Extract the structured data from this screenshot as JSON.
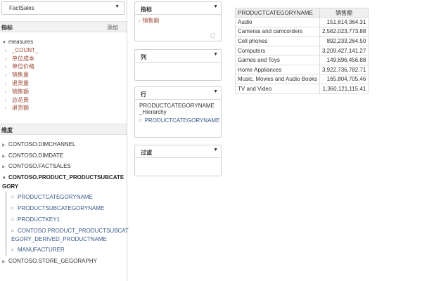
{
  "cube": {
    "selected": "FactSales"
  },
  "measures_section": {
    "title": "指标",
    "add_label": "添加"
  },
  "measures_root": "measures",
  "measures": [
    "_COUNT_",
    "单位成本",
    "单位价格",
    "销售量",
    "退货量",
    "销售额",
    "总花费",
    "退货额"
  ],
  "dimensions_section": {
    "title": "维度"
  },
  "dimensions": {
    "dim1": "CONTOSO.DIMCHANNEL",
    "dim2": "CONTOSO.DIMDATE",
    "dim3": "CONTOSO.FACTSALES",
    "dim4": "CONTOSO.PRODUCT_PRODUCTSUBCATEGORY",
    "dim5": "CONTOSO.STORE_GEGORAPHY"
  },
  "attributes": [
    "PRODUCTCATEGORYNAME",
    "PRODUCTSUBCATEGORYNAME",
    "PRODUCTKEY1",
    "CONTOSO.PRODUCT_PRODUCTSUBCATEGORY_DERIVED_PRODUCTNAME",
    "MANUFACTURER"
  ],
  "panels": {
    "measures": {
      "title": "指标",
      "item": "销售额"
    },
    "columns": {
      "title": "列"
    },
    "rows": {
      "title": "行",
      "hierarchy": "PRODUCTCATEGORYNAME_Hierarchy",
      "item": "PRODUCTCATEGORYNAME"
    },
    "filters": {
      "title": "过滤"
    }
  },
  "table": {
    "headers": [
      "PRODUCTCATEGORYNAME",
      "销售额"
    ],
    "rows": [
      [
        "Audio",
        "151,614,364.31"
      ],
      [
        "Cameras and camcorders",
        "2,562,023,773.88"
      ],
      [
        "Cell phones",
        "892,233,264.50"
      ],
      [
        "Computers",
        "3,209,427,141.27"
      ],
      [
        "Games and Toys",
        "149,696,456.88"
      ],
      [
        "Home Appliances",
        "3,922,736,782.71"
      ],
      [
        "Music, Movies and Audio Books",
        "165,804,705.46"
      ],
      [
        "TV and Video",
        "1,360,121,115.41"
      ]
    ]
  }
}
